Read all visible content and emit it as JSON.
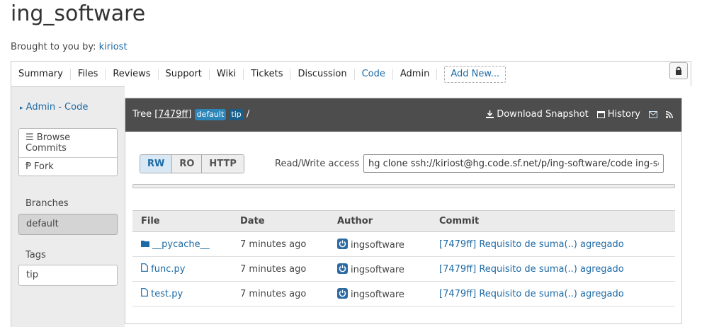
{
  "project": {
    "title": "ing_software",
    "byline_prefix": "Brought to you by:",
    "byline_user": "kiriost"
  },
  "nav": {
    "items": [
      "Summary",
      "Files",
      "Reviews",
      "Support",
      "Wiki",
      "Tickets",
      "Discussion",
      "Code",
      "Admin"
    ],
    "active": "Code",
    "add_new": "Add New..."
  },
  "sidebar": {
    "admin_link": "Admin - Code",
    "browse_commits": "Browse Commits",
    "fork": "Fork",
    "branches_label": "Branches",
    "branch_selected": "default",
    "tags_label": "Tags",
    "tag": "tip"
  },
  "header": {
    "tree_label": "Tree",
    "commit": "[7479ff]",
    "branch_badge": "default",
    "tip_badge": "tip",
    "path_sep": "/",
    "download": "Download Snapshot",
    "history": "History"
  },
  "clone": {
    "buttons": [
      "RW",
      "RO",
      "HTTP"
    ],
    "selected": "RW",
    "access_label": "Read/Write access",
    "command": "hg clone ssh://kiriost@hg.code.sf.net/p/ing-software/code ing-software"
  },
  "table": {
    "headers": [
      "File",
      "Date",
      "Author",
      "Commit"
    ],
    "rows": [
      {
        "name": "__pycache__",
        "type": "folder",
        "date": "7 minutes ago",
        "author": "ingsoftware",
        "commit": "[7479ff] Requisito de suma(..) agregado"
      },
      {
        "name": "func.py",
        "type": "file",
        "date": "7 minutes ago",
        "author": "ingsoftware",
        "commit": "[7479ff] Requisito de suma(..) agregado"
      },
      {
        "name": "test.py",
        "type": "file",
        "date": "7 minutes ago",
        "author": "ingsoftware",
        "commit": "[7479ff] Requisito de suma(..) agregado"
      }
    ]
  }
}
